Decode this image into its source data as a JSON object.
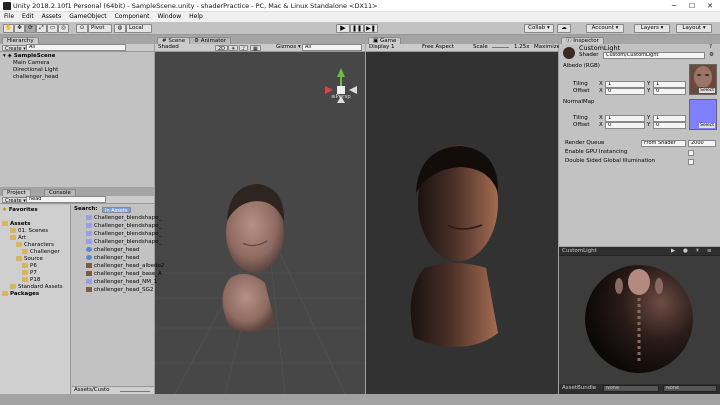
{
  "window": {
    "title": "Unity 2018.2.10f1 Personal (64bit) - SampleScene.unity - shaderPractice - PC, Mac & Linux Standalone <DX11>"
  },
  "menu": [
    "File",
    "Edit",
    "Assets",
    "GameObject",
    "Component",
    "Window",
    "Help"
  ],
  "toolbar": {
    "pivot": "Pivot",
    "local": "Local",
    "collab": "Collab ▾",
    "account": "Account ▾",
    "layers": "Layers ▾",
    "layout": "Layout ▾"
  },
  "hierarchy": {
    "tab": "Hierarchy",
    "create": "Create ▾",
    "search_placeholder": "All",
    "scene": "SampleScene",
    "items": [
      "Main Camera",
      "Directional Light",
      "challenger_head"
    ]
  },
  "scene_view": {
    "tabs": [
      "Scene",
      "Animator"
    ],
    "shaded": "Shaded",
    "mode_2d": "2D",
    "gizmos": "Gizmos ▾",
    "search_placeholder": "All",
    "persp": "Persp"
  },
  "game_view": {
    "tab": "Game",
    "display": "Display 1",
    "aspect": "Free Aspect",
    "scale_label": "Scale",
    "scale_value": "1.25x",
    "maximize": "Maximize"
  },
  "project": {
    "tabs": [
      "Project",
      "Console"
    ],
    "create": "Create ▾",
    "search_value": "head",
    "favorites": "Favorites",
    "tree": {
      "assets": "Assets",
      "scenes": "01. Scenes",
      "art": "Art",
      "characters": "Characters",
      "challenger": "Challenger",
      "source": "Source",
      "p6": "P6",
      "p7": "P7",
      "p18": "P18",
      "standard_assets": "Standard Assets",
      "packages": "Packages"
    },
    "search_label": "Search:",
    "search_scope": "In Assets",
    "results": [
      {
        "name": "Challenger_blendshape_",
        "icon": "mat"
      },
      {
        "name": "Challenger_blendshape_",
        "icon": "mat"
      },
      {
        "name": "Challenger_blendshape_",
        "icon": "mat"
      },
      {
        "name": "Challenger_blendshape_",
        "icon": "mat"
      },
      {
        "name": "challenger_head",
        "icon": "mesh"
      },
      {
        "name": "challenger_head",
        "icon": "mesh"
      },
      {
        "name": "challenger_head_albedo2",
        "icon": "tex"
      },
      {
        "name": "challenger_head_base_A",
        "icon": "tex"
      },
      {
        "name": "challenger_head_NM_1",
        "icon": "mat"
      },
      {
        "name": "challenger_head_SG2",
        "icon": "tex"
      }
    ],
    "path": "Assets/Custo"
  },
  "inspector": {
    "tab": "Inspector",
    "name": "CustomLight",
    "shader_label": "Shader",
    "shader_value": "Custom/CustomLight",
    "albedo_label": "Albedo (RGB)",
    "tiling": "Tiling",
    "offset": "Offset",
    "x": "X",
    "y": "Y",
    "albedo_tiling": [
      "1",
      "1"
    ],
    "albedo_offset": [
      "0",
      "0"
    ],
    "normal_label": "NormalMap",
    "normal_tiling": [
      "1",
      "1"
    ],
    "normal_offset": [
      "0",
      "0"
    ],
    "select": "Select",
    "render_queue_label": "Render Queue",
    "render_queue_mode": "From Shader",
    "render_queue_value": "2000",
    "gpu_instancing": "Enable GPU Instancing",
    "double_sided_gi": "Double Sided Global Illumination",
    "preview_title": "CustomLight",
    "asset_bundle_label": "AssetBundle",
    "asset_bundle_value": "None",
    "asset_bundle_variant": "None",
    "colors": {
      "normal_swatch": "#8080ff"
    }
  }
}
